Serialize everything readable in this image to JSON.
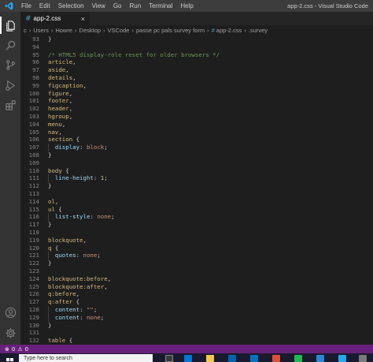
{
  "titlebar": {
    "menu": [
      "File",
      "Edit",
      "Selection",
      "View",
      "Go",
      "Run",
      "Terminal",
      "Help"
    ],
    "window_title": "app-2.css - Visual Studio Code"
  },
  "activitybar": {
    "icons": [
      "explorer-icon",
      "search-icon",
      "source-control-icon",
      "run-debug-icon",
      "extensions-icon",
      "account-icon",
      "settings-gear-icon"
    ]
  },
  "tab": {
    "label": "app-2.css",
    "close": "×"
  },
  "breadcrumb": [
    "c",
    "Users",
    "Howre",
    "Desktop",
    "VSCode",
    "passe pc pals survey form",
    "app-2.css",
    ".survey"
  ],
  "editor": {
    "lines": [
      {
        "n": "93",
        "code": "}"
      },
      {
        "n": "94",
        "code": ""
      },
      {
        "n": "95",
        "code": "/* HTML5 display-role reset for older browsers */"
      },
      {
        "n": "96",
        "code": "article,"
      },
      {
        "n": "97",
        "code": "aside,"
      },
      {
        "n": "98",
        "code": "details,"
      },
      {
        "n": "99",
        "code": "figcaption,"
      },
      {
        "n": "100",
        "code": "figure,"
      },
      {
        "n": "101",
        "code": "footer,"
      },
      {
        "n": "102",
        "code": "header,"
      },
      {
        "n": "103",
        "code": "hgroup,"
      },
      {
        "n": "104",
        "code": "menu,"
      },
      {
        "n": "105",
        "code": "nav,"
      },
      {
        "n": "106",
        "code": "section {"
      },
      {
        "n": "107",
        "code": "  display: block;"
      },
      {
        "n": "108",
        "code": "}"
      },
      {
        "n": "109",
        "code": ""
      },
      {
        "n": "110",
        "code": "body {"
      },
      {
        "n": "111",
        "code": "  line-height: 1;"
      },
      {
        "n": "112",
        "code": "}"
      },
      {
        "n": "113",
        "code": ""
      },
      {
        "n": "114",
        "code": "ol,"
      },
      {
        "n": "115",
        "code": "ul {"
      },
      {
        "n": "116",
        "code": "  list-style: none;"
      },
      {
        "n": "117",
        "code": "}"
      },
      {
        "n": "118",
        "code": ""
      },
      {
        "n": "119",
        "code": "blockquote,"
      },
      {
        "n": "120",
        "code": "q {"
      },
      {
        "n": "121",
        "code": "  quotes: none;"
      },
      {
        "n": "122",
        "code": "}"
      },
      {
        "n": "123",
        "code": ""
      },
      {
        "n": "124",
        "code": "blockquote:before,"
      },
      {
        "n": "125",
        "code": "blockquote:after,"
      },
      {
        "n": "126",
        "code": "q:before,"
      },
      {
        "n": "127",
        "code": "q:after {"
      },
      {
        "n": "128",
        "code": "  content: \"\";"
      },
      {
        "n": "129",
        "code": "  content: none;"
      },
      {
        "n": "130",
        "code": "}"
      },
      {
        "n": "131",
        "code": ""
      },
      {
        "n": "132",
        "code": "table {"
      }
    ]
  },
  "statusbar": {
    "errors": "0",
    "warnings": "0"
  },
  "taskbar": {
    "search_placeholder": "Type here to search"
  },
  "colors": {
    "statusbar": "#68217a",
    "accent_css_icon": "#519aba"
  }
}
